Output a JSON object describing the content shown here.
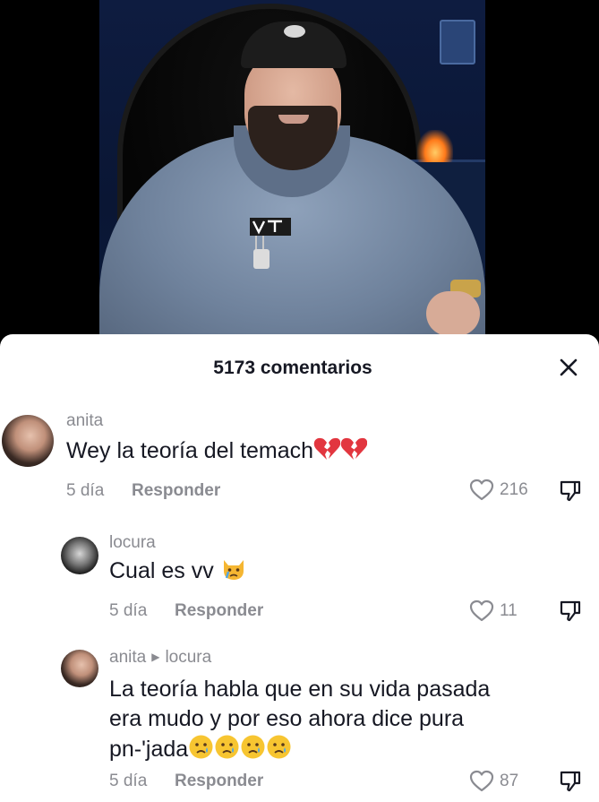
{
  "sheet": {
    "comment_count_label": "5173 comentarios"
  },
  "comments": [
    {
      "username": "anita",
      "text": "Wey la teoría del temach",
      "emojis": [
        "broken-heart",
        "broken-heart"
      ],
      "age": "5 día",
      "reply_label": "Responder",
      "likes": "216"
    },
    {
      "username": "locura",
      "text": "Cual es vv",
      "emojis": [
        "crying-cat"
      ],
      "age": "5 día",
      "reply_label": "Responder",
      "likes": "11"
    },
    {
      "username": "anita",
      "reply_to": "locura",
      "text_line1": "La teoría habla que en su vida pasada",
      "text_line2": "era mudo y por eso ahora dice pura",
      "text_line3": "pn-'jada",
      "emojis": [
        "crying-face",
        "crying-face",
        "crying-face",
        "crying-face"
      ],
      "age": "5 día",
      "reply_label": "Responder",
      "likes": "87"
    }
  ],
  "colors": {
    "text_primary": "#161823",
    "text_secondary": "#8a8b91",
    "sheet_bg": "#ffffff",
    "page_bg": "#000000"
  }
}
